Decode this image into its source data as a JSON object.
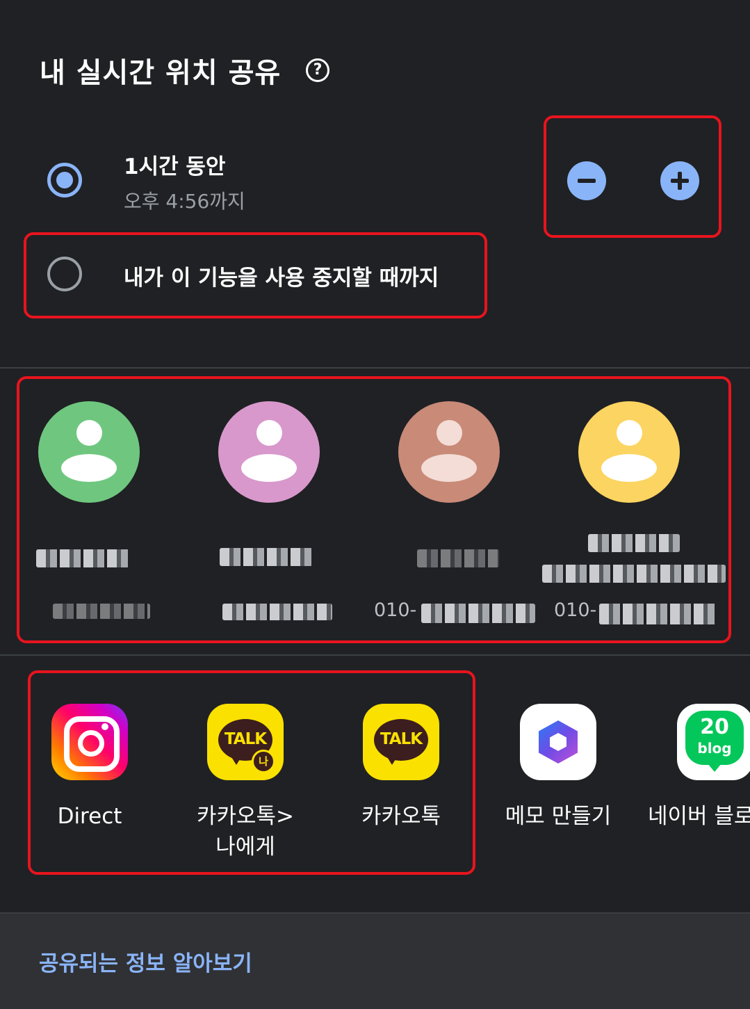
{
  "header": {
    "title": "내 실시간 위치 공유",
    "help_icon": "?"
  },
  "duration": {
    "option1": {
      "label": "1시간 동안",
      "sublabel": "오후 4:56까지",
      "selected": true
    },
    "option2": {
      "label": "내가 이 기능을 사용 중지할 때까지",
      "selected": false
    },
    "stepper": {
      "minus_icon": "minus-icon",
      "plus_icon": "plus-icon"
    }
  },
  "contacts": [
    {
      "color": "#6fc77f",
      "phone": ""
    },
    {
      "color": "#d898cc",
      "phone": ""
    },
    {
      "color": "#c98a78",
      "phone": "010-"
    },
    {
      "color": "#fcd461",
      "phone": "010-"
    }
  ],
  "apps": [
    {
      "label": "Direct",
      "icon": "instagram-icon"
    },
    {
      "label": "카카오톡>\n나에게",
      "icon": "kakaotalk-me-icon",
      "badge_text": "TALK",
      "badge_sub": "나"
    },
    {
      "label": "카카오톡",
      "icon": "kakaotalk-icon",
      "badge_text": "TALK"
    },
    {
      "label": "메모 만들기",
      "icon": "microsoft365-icon"
    },
    {
      "label": "네이버 블로",
      "icon": "naver-blog-icon",
      "badge_num": "20",
      "badge_word": "blog"
    }
  ],
  "footer": {
    "link": "공유되는 정보 알아보기"
  },
  "colors": {
    "background": "#202124",
    "accent": "#8ab4f8",
    "highlight": "#e8141e"
  }
}
